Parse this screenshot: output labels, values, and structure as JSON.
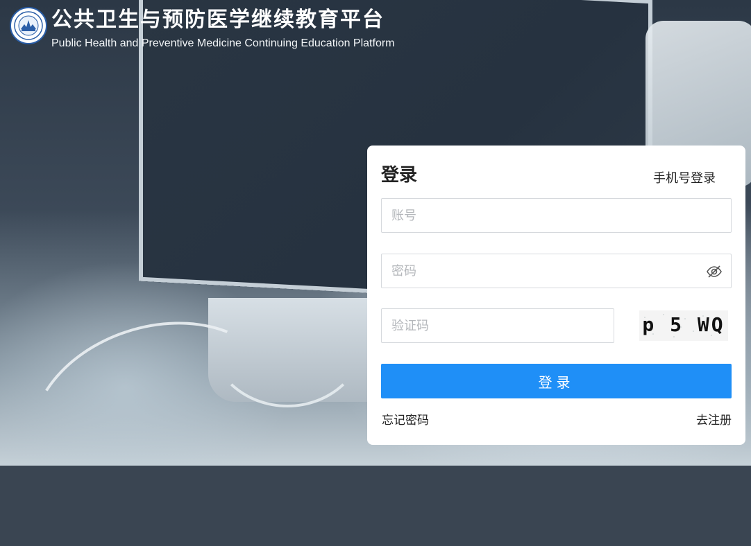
{
  "brand": {
    "title_cn": "公共卫生与预防医学继续教育平台",
    "title_en": "Public Health and Preventive Medicine Continuing Education Platform",
    "logo_icon": "association-seal-logo",
    "logo_color": "#2a5ea8"
  },
  "login": {
    "title": "登录",
    "phone_login_label": "手机号登录",
    "account_placeholder": "账号",
    "password_placeholder": "密码",
    "password_toggle_icon": "eye-off-icon",
    "captcha_placeholder": "验证码",
    "captcha_text": "p 5 WQ",
    "submit_label": "登录",
    "forgot_password_label": "忘记密码",
    "register_label": "去注册",
    "accent_color": "#1f8ff7"
  }
}
